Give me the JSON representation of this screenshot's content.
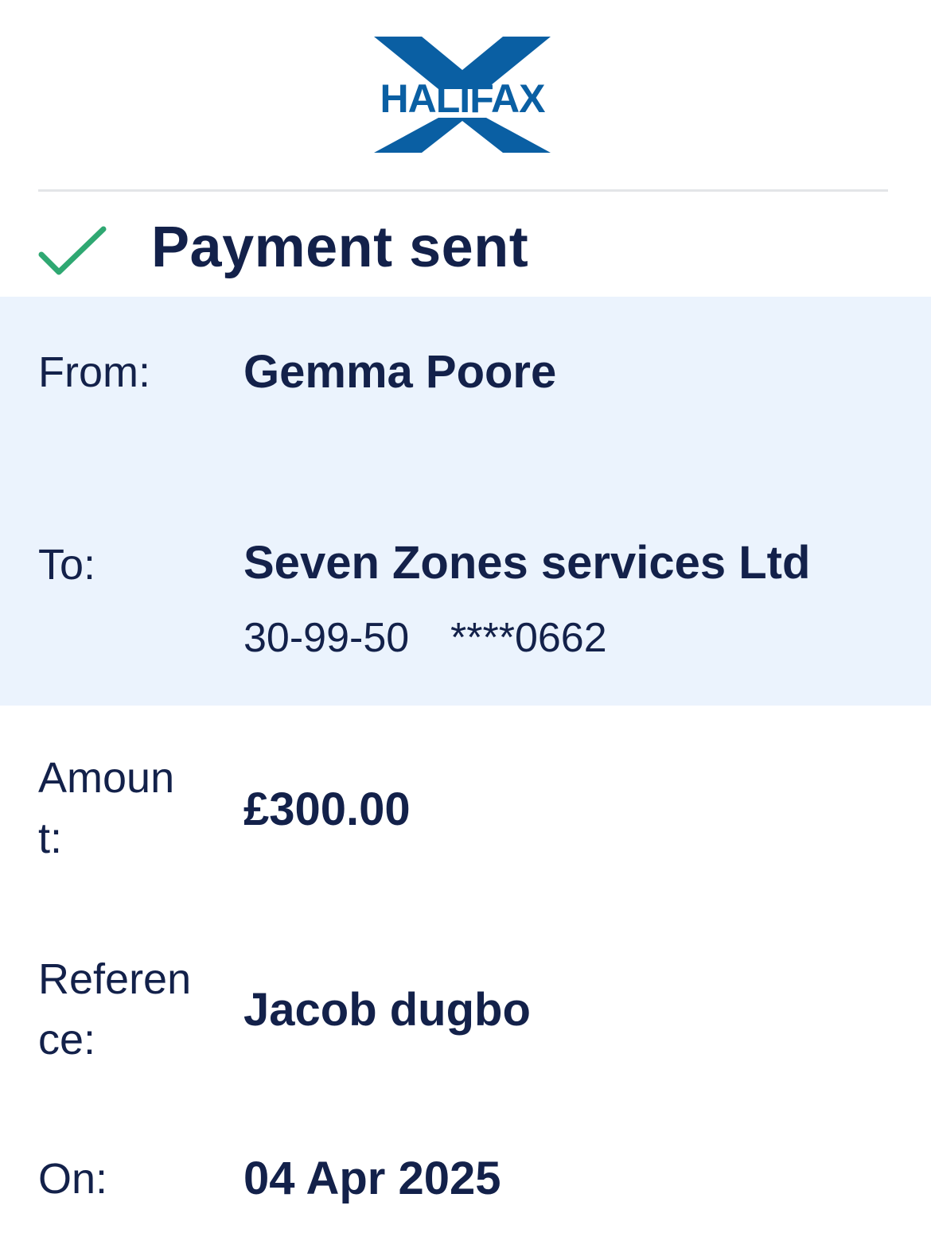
{
  "brand": {
    "logo_text": "HALIFAX",
    "logo_color": "#0a5fa3"
  },
  "status": {
    "title": "Payment sent",
    "icon": "check-icon",
    "icon_color": "#2fa872"
  },
  "details": {
    "from_label": "From:",
    "from_value": "Gemma Poore",
    "to_label": "To:",
    "to_value": "Seven Zones services Ltd",
    "sort_code": "30-99-50",
    "account_number": "****0662",
    "amount_label": "Amount:",
    "amount_value": "£300.00",
    "reference_label": "Reference:",
    "reference_value": "Jacob dugbo",
    "date_label": "On:",
    "date_value": "04 Apr 2025"
  },
  "colors": {
    "text": "#13214a",
    "highlight_bg": "#ebf3fd",
    "divider": "#e3e5e8"
  }
}
